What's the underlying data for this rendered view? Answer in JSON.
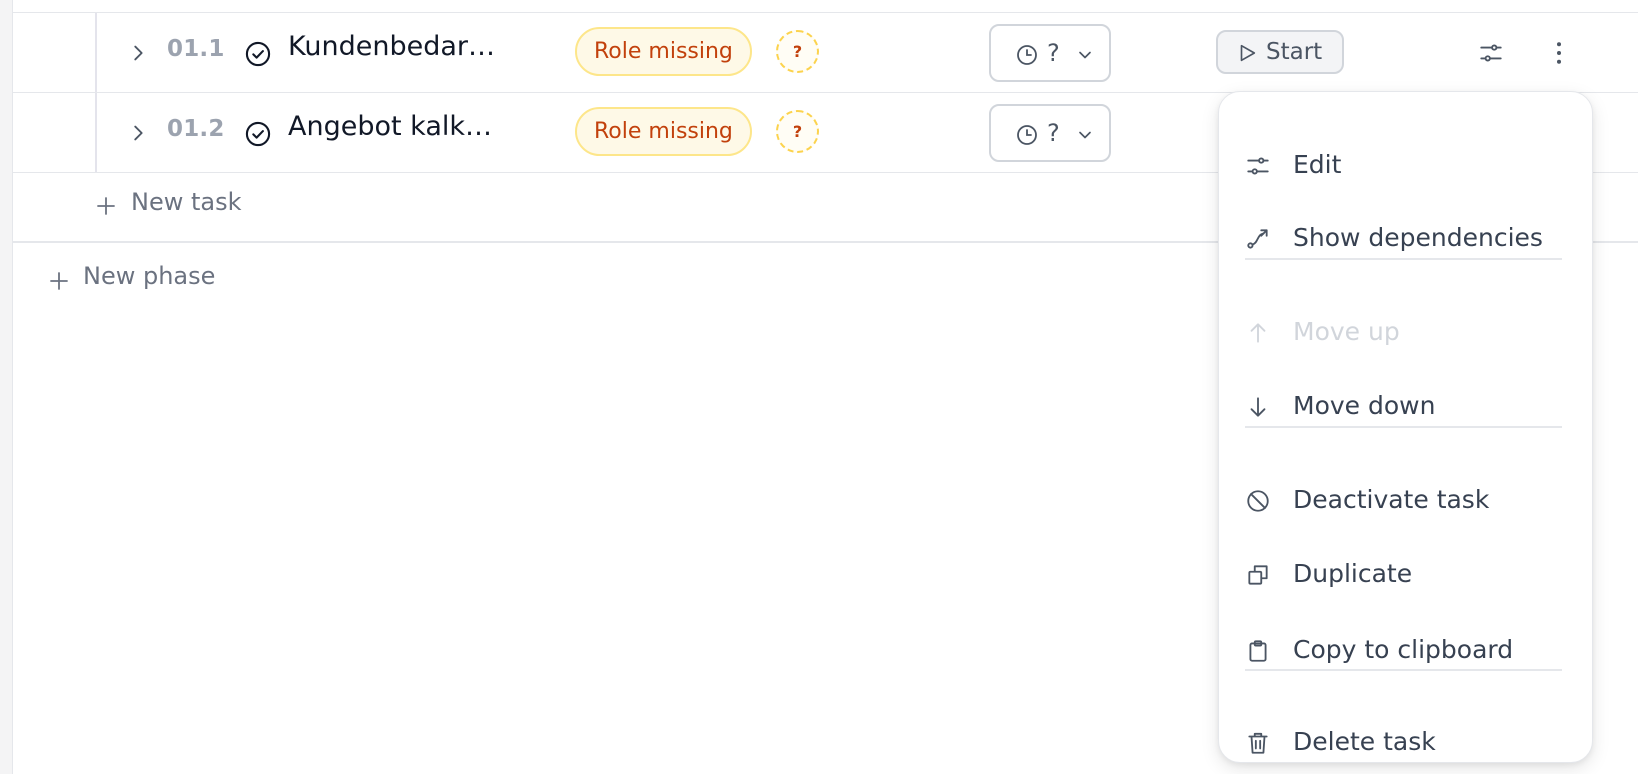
{
  "tasks": [
    {
      "number": "01.1",
      "title": "Kundenbedar…",
      "role_badge": "Role missing",
      "assignee_placeholder": "?",
      "time_value": "?",
      "start_label": "Start"
    },
    {
      "number": "01.2",
      "title": "Angebot kalk…",
      "role_badge": "Role missing",
      "assignee_placeholder": "?",
      "time_value": "?"
    }
  ],
  "new_task_label": "New task",
  "new_phase_label": "New phase",
  "context_menu": {
    "items": [
      {
        "label": "Edit",
        "icon": "sliders-icon",
        "disabled": false
      },
      {
        "label": "Show dependencies",
        "icon": "dependencies-icon",
        "disabled": false
      },
      {
        "label": "Move up",
        "icon": "arrow-up-icon",
        "disabled": true
      },
      {
        "label": "Move down",
        "icon": "arrow-down-icon",
        "disabled": false
      },
      {
        "label": "Deactivate task",
        "icon": "ban-icon",
        "disabled": false
      },
      {
        "label": "Duplicate",
        "icon": "duplicate-icon",
        "disabled": false
      },
      {
        "label": "Copy to clipboard",
        "icon": "clipboard-icon",
        "disabled": false
      },
      {
        "label": "Delete task",
        "icon": "trash-icon",
        "disabled": false
      }
    ]
  },
  "colors": {
    "badge_text": "#c2410c",
    "badge_border": "#fde68a",
    "badge_bg": "#fef9e7",
    "muted_text": "#6b7280",
    "disabled_text": "#d1d5db"
  }
}
